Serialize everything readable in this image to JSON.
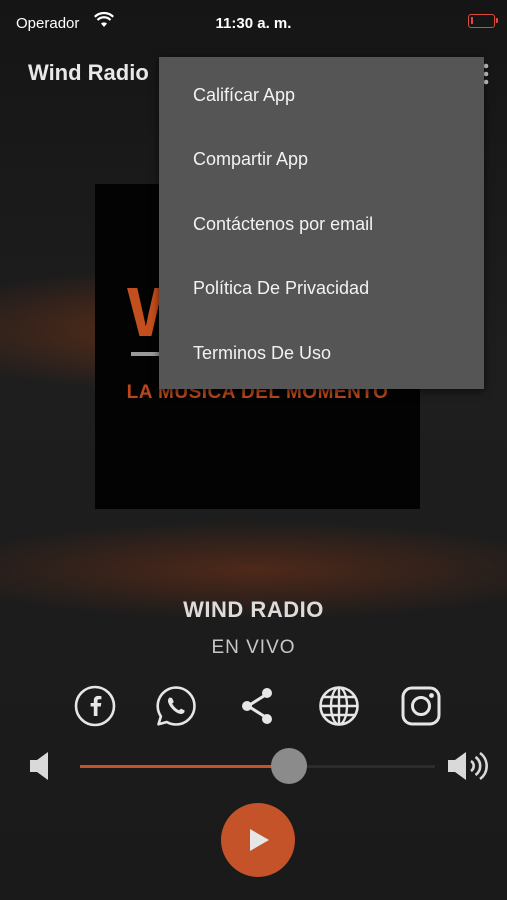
{
  "status_bar": {
    "carrier": "Operador",
    "time": "11:30 a. m.",
    "battery_level": 0.1,
    "battery_color": "#e0443a"
  },
  "app_bar": {
    "title": "Wind Radio",
    "more_icon": "more-vertical-icon"
  },
  "menu": {
    "items": [
      {
        "label": "Califícar App"
      },
      {
        "label": "Compartir App"
      },
      {
        "label": "Contáctenos por email"
      },
      {
        "label": "Política De Privacidad"
      },
      {
        "label": "Terminos De Uso"
      }
    ]
  },
  "cover": {
    "logo_letter": "W",
    "slogan": "LA MUSICA DEL MOMENTO"
  },
  "player": {
    "station_name": "WIND RADIO",
    "status": "EN VIVO",
    "volume_level": 0.59,
    "accent_color": "#c4532a"
  },
  "socials": [
    {
      "icon": "facebook-icon"
    },
    {
      "icon": "whatsapp-icon"
    },
    {
      "icon": "share-icon"
    },
    {
      "icon": "globe-icon"
    },
    {
      "icon": "instagram-icon"
    }
  ]
}
